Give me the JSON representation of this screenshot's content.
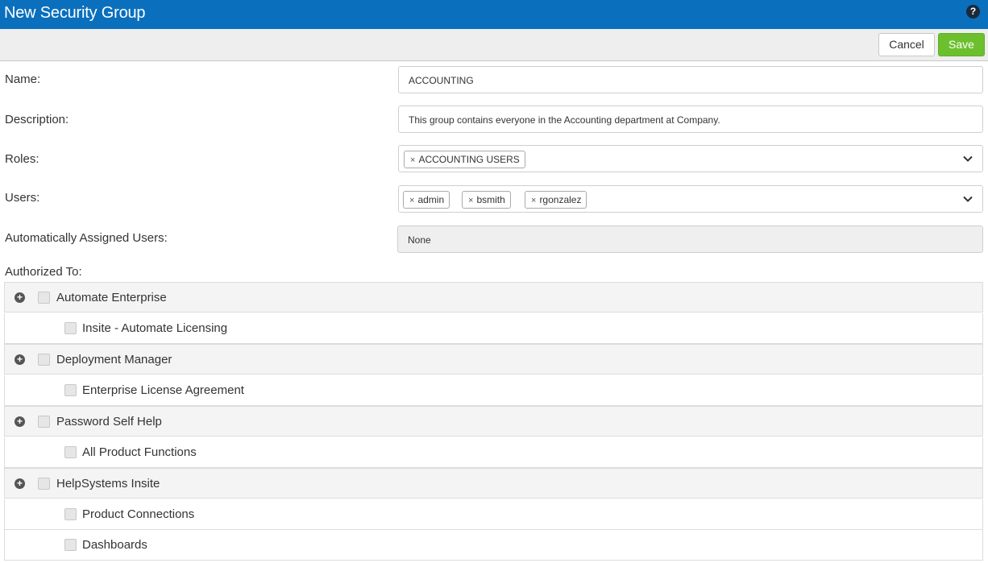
{
  "window": {
    "title": "New Security Group"
  },
  "toolbar": {
    "cancel_label": "Cancel",
    "save_label": "Save"
  },
  "form": {
    "name": {
      "label": "Name:",
      "value": "ACCOUNTING"
    },
    "description": {
      "label": "Description:",
      "value": "This group contains everyone in the Accounting department at Company."
    },
    "roles": {
      "label": "Roles:",
      "tags": [
        "ACCOUNTING USERS"
      ]
    },
    "users": {
      "label": "Users:",
      "tags": [
        "admin",
        "bsmith",
        "rgonzalez"
      ]
    },
    "auto_users": {
      "label": "Automatically Assigned Users:",
      "value": "None"
    },
    "authorized": {
      "label": "Authorized To:"
    }
  },
  "tag_remove_glyph": "×",
  "tree": [
    {
      "label": "Automate Enterprise",
      "children": [
        "Insite - Automate Licensing"
      ]
    },
    {
      "label": "Deployment Manager",
      "children": [
        "Enterprise License Agreement"
      ]
    },
    {
      "label": "Password Self Help",
      "children": [
        "All Product Functions"
      ]
    },
    {
      "label": "HelpSystems Insite",
      "children": [
        "Product Connections",
        "Dashboards"
      ]
    }
  ],
  "icons": {
    "help": "question-circle-icon",
    "expand": "plus-circle-icon",
    "dropdown": "chevron-down-icon"
  },
  "colors": {
    "titlebar": "#0a6fbd",
    "save_button": "#6cc02e"
  }
}
